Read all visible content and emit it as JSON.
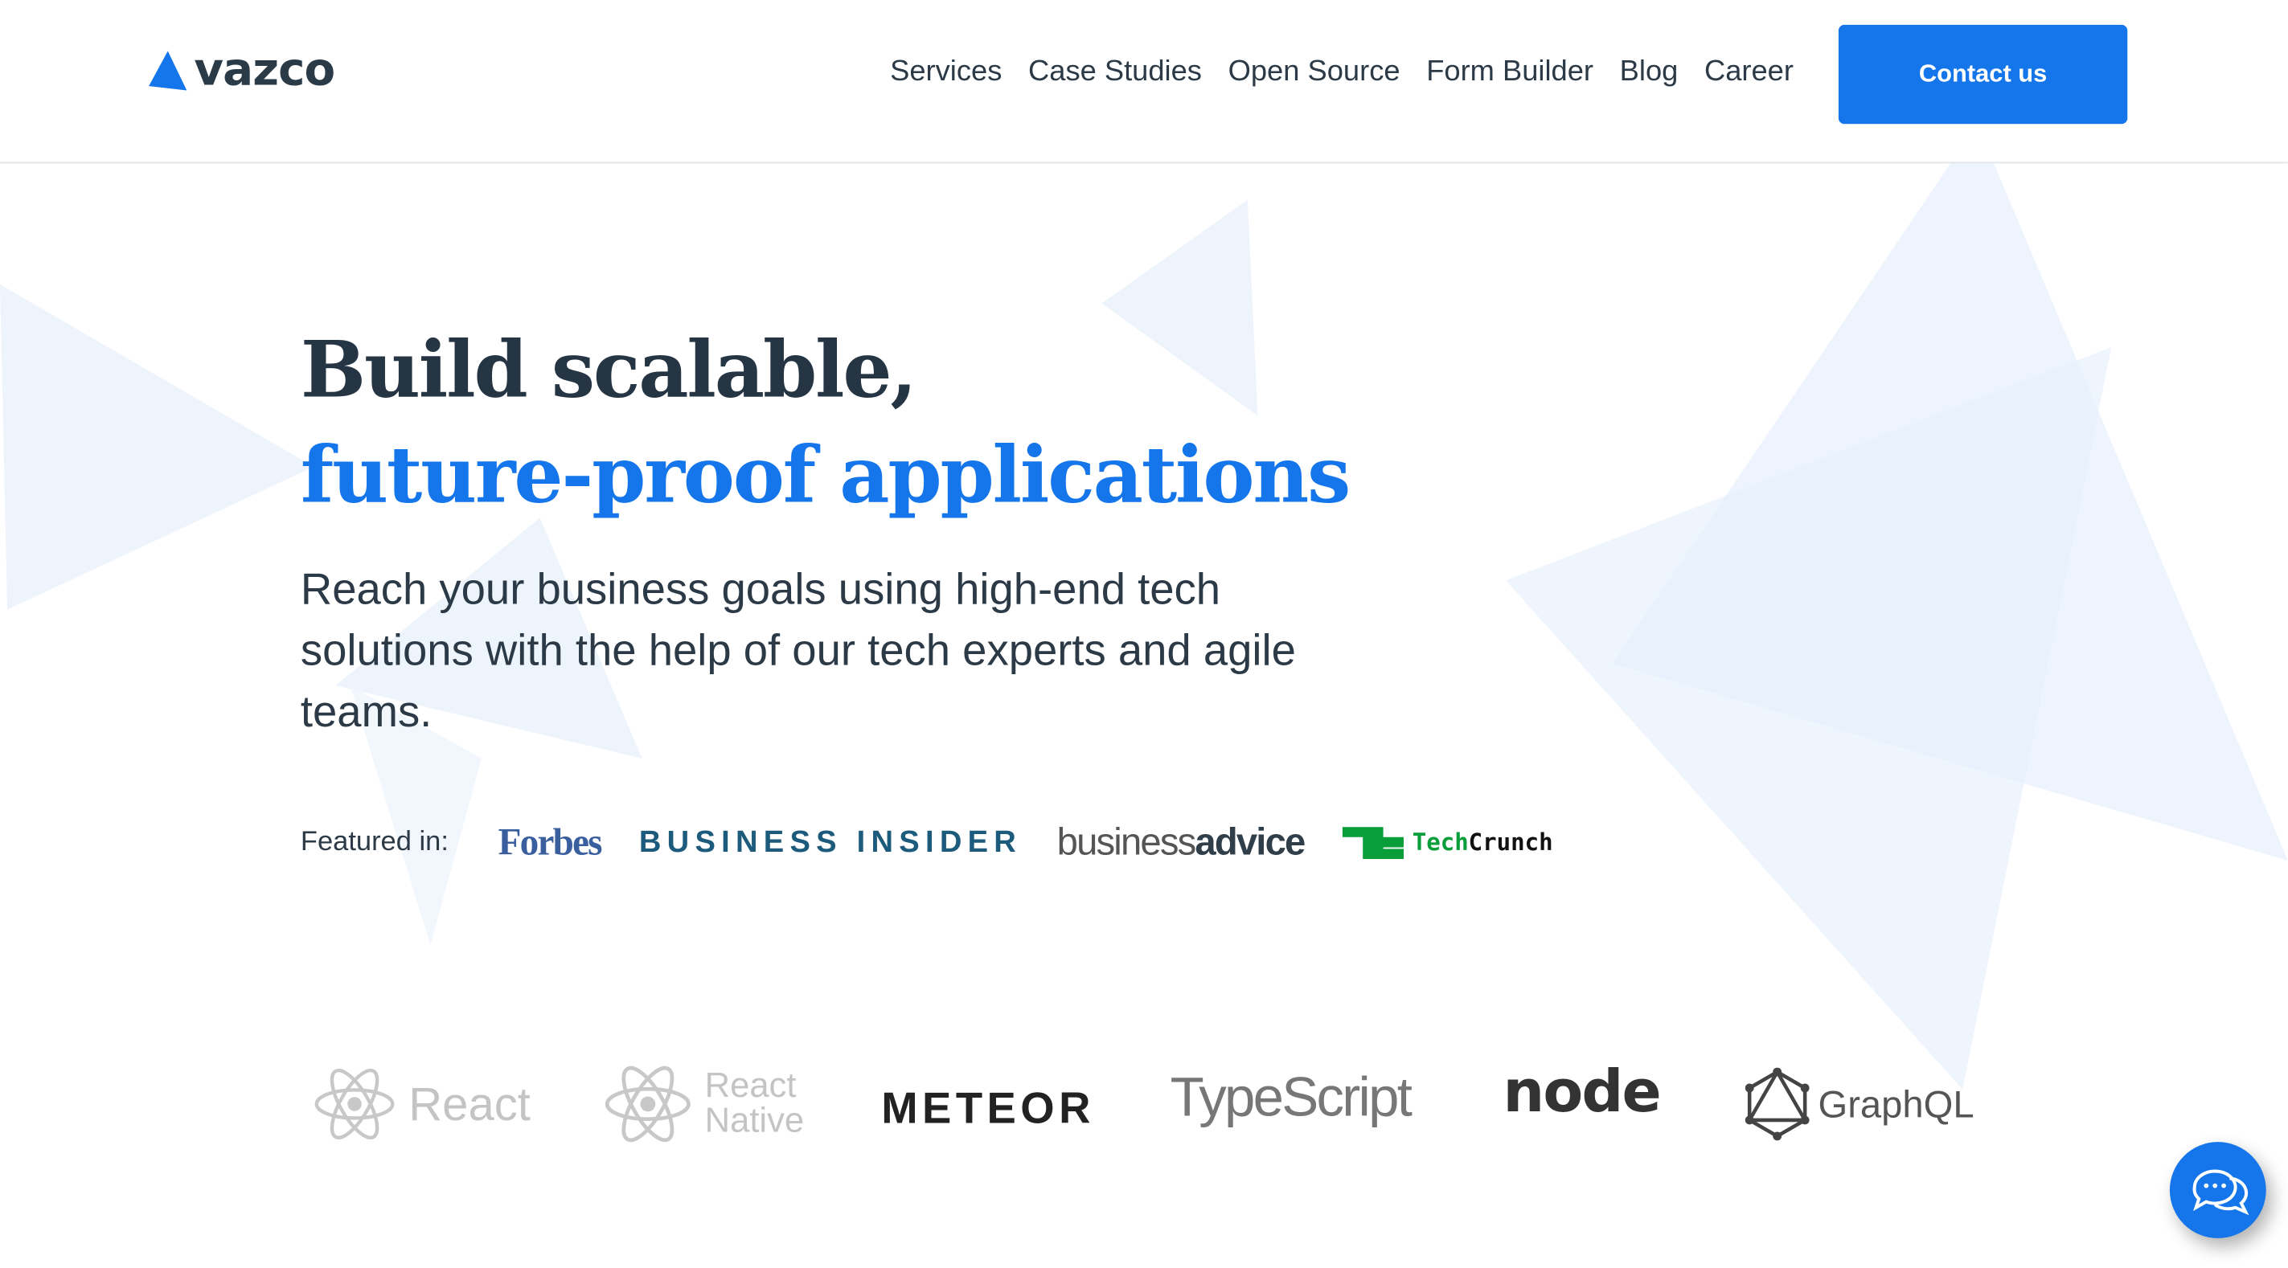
{
  "brand": {
    "name": "vazco",
    "accent": "#1476ea",
    "text_color": "#263544"
  },
  "nav": {
    "items": [
      "Services",
      "Case Studies",
      "Open Source",
      "Form Builder",
      "Blog",
      "Career"
    ],
    "contact_label": "Contact us"
  },
  "hero": {
    "title_line1": "Build scalable,",
    "title_line2": "future-proof applications",
    "subtitle": "Reach your business goals using high-end tech solutions with the help of our tech experts and agile teams."
  },
  "featured": {
    "label": "Featured in:",
    "logos": {
      "forbes": "Forbes",
      "business_insider": "BUSINESS INSIDER",
      "businessadvice_light": "business",
      "businessadvice_bold": "advice",
      "techcrunch_tech": "Tech",
      "techcrunch_crunch": "Crunch"
    }
  },
  "technologies": {
    "react": "React",
    "react_native_1": "React",
    "react_native_2": "Native",
    "meteor": "METEOR",
    "typescript": "TypeScript",
    "node": "node",
    "graphql": "GraphQL"
  },
  "chat": {
    "icon": "chat-bubbles-icon"
  }
}
